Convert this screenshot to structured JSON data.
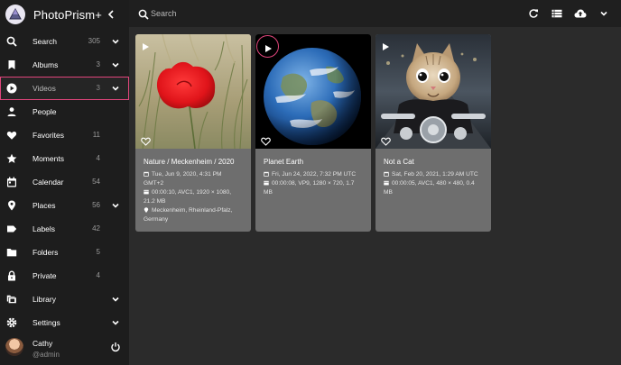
{
  "app": {
    "name": "PhotoPrism+"
  },
  "search": {
    "placeholder": "Search"
  },
  "sidebar": {
    "items": [
      {
        "label": "Search",
        "count": "305",
        "chevron": true
      },
      {
        "label": "Albums",
        "count": "3",
        "chevron": true
      },
      {
        "label": "Videos",
        "count": "3",
        "chevron": true,
        "active": true
      },
      {
        "label": "People",
        "count": "",
        "chevron": false
      },
      {
        "label": "Favorites",
        "count": "11",
        "chevron": false
      },
      {
        "label": "Moments",
        "count": "4",
        "chevron": false
      },
      {
        "label": "Calendar",
        "count": "54",
        "chevron": false
      },
      {
        "label": "Places",
        "count": "56",
        "chevron": true
      },
      {
        "label": "Labels",
        "count": "42",
        "chevron": false
      },
      {
        "label": "Folders",
        "count": "5",
        "chevron": false
      },
      {
        "label": "Private",
        "count": "4",
        "chevron": false
      },
      {
        "label": "Library",
        "count": "",
        "chevron": true
      },
      {
        "label": "Settings",
        "count": "",
        "chevron": true
      }
    ]
  },
  "user": {
    "name": "Cathy",
    "handle": "@admin"
  },
  "toolbar": {
    "icons": [
      "refresh-icon",
      "list-view-icon",
      "upload-cloud-icon",
      "chevron-down-icon"
    ]
  },
  "cards": [
    {
      "title": "Nature / Meckenheim / 2020",
      "date_line1": "Tue, Jun 9, 2020, 4:31 PM",
      "date_line2": "GMT+2",
      "video_line1": "00:00:10, AVC1, 1920 × 1080,",
      "video_line2": "21.2 MB",
      "location_line1": "Meckenheim, Rheinland-Pfalz,",
      "location_line2": "Germany"
    },
    {
      "title": "Planet Earth",
      "date_line1": "Fri, Jun 24, 2022, 7:32 PM UTC",
      "video_line1": "00:00:08, VP9, 1280 × 720, 1.7",
      "video_line2": "MB"
    },
    {
      "title": "Not a Cat",
      "date_line1": "Sat, Feb 20, 2021, 1:29 AM UTC",
      "video_line1": "00:00:05, AVC1, 480 × 480, 0.4",
      "video_line2": "MB"
    }
  ],
  "colors": {
    "accent": "#e0457b",
    "sidebar_bg": "#1d1d1d",
    "content_bg": "#2b2b2b",
    "card_bg": "#6e6e6e"
  }
}
